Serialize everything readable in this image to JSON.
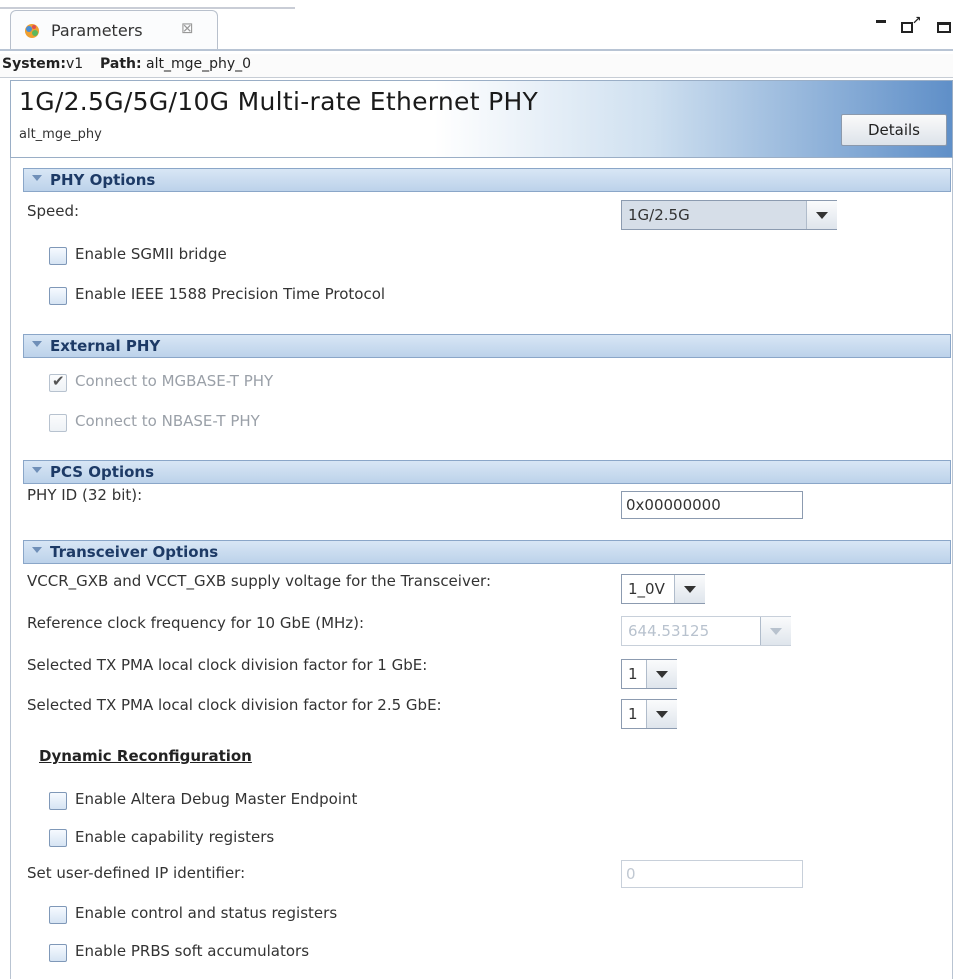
{
  "tab": {
    "icon": "parameters-icon",
    "label": "Parameters",
    "close_icon": "close-icon",
    "close_glyph": "⊠"
  },
  "window_controls": {
    "minimize_icon": "minimize-icon",
    "restore_icon": "restore-icon",
    "maximize_icon": "maximize-icon"
  },
  "system_path": {
    "system_label": "System:",
    "system_value": "v1",
    "path_label": "Path:",
    "path_value": "alt_mge_phy_0"
  },
  "header": {
    "title": "1G/2.5G/5G/10G Multi-rate Ethernet PHY",
    "subtitle": "alt_mge_phy",
    "details_label": "Details",
    "accent_color": "#5f8fc8"
  },
  "sections": {
    "phy_options": {
      "title": "PHY Options",
      "speed_label": "Speed:",
      "speed_value": "1G/2.5G",
      "sgmii_label": "Enable SGMII bridge",
      "sgmii_checked": false,
      "ieee1588_label": "Enable IEEE 1588 Precision Time Protocol",
      "ieee1588_checked": false
    },
    "external_phy": {
      "title": "External PHY",
      "mgbase_label": "Connect to MGBASE-T PHY",
      "mgbase_checked": true,
      "nbase_label": "Connect to NBASE-T PHY",
      "nbase_checked": false
    },
    "pcs_options": {
      "title": "PCS Options",
      "phy_id_label": "PHY ID (32 bit):",
      "phy_id_value": "0x00000000"
    },
    "transceiver_options": {
      "title": "Transceiver Options",
      "vccr_label": "VCCR_GXB and VCCT_GXB supply voltage for the Transceiver:",
      "vccr_value": "1_0V",
      "refclk_label": "Reference clock frequency for 10 GbE (MHz):",
      "refclk_value": "644.53125",
      "tx1g_label": "Selected TX PMA local clock division factor for 1 GbE:",
      "tx1g_value": "1",
      "tx25g_label": "Selected TX PMA local clock division factor for 2.5 GbE:",
      "tx25g_value": "1",
      "dynamic_title": "Dynamic Reconfiguration",
      "debug_label": "Enable Altera Debug Master Endpoint",
      "debug_checked": false,
      "capability_label": "Enable capability registers",
      "capability_checked": false,
      "ip_id_label": "Set user-defined IP identifier:",
      "ip_id_value": "0",
      "csr_label": "Enable control and status registers",
      "csr_checked": false,
      "prbs_label": "Enable PRBS soft accumulators",
      "prbs_checked": false
    }
  }
}
